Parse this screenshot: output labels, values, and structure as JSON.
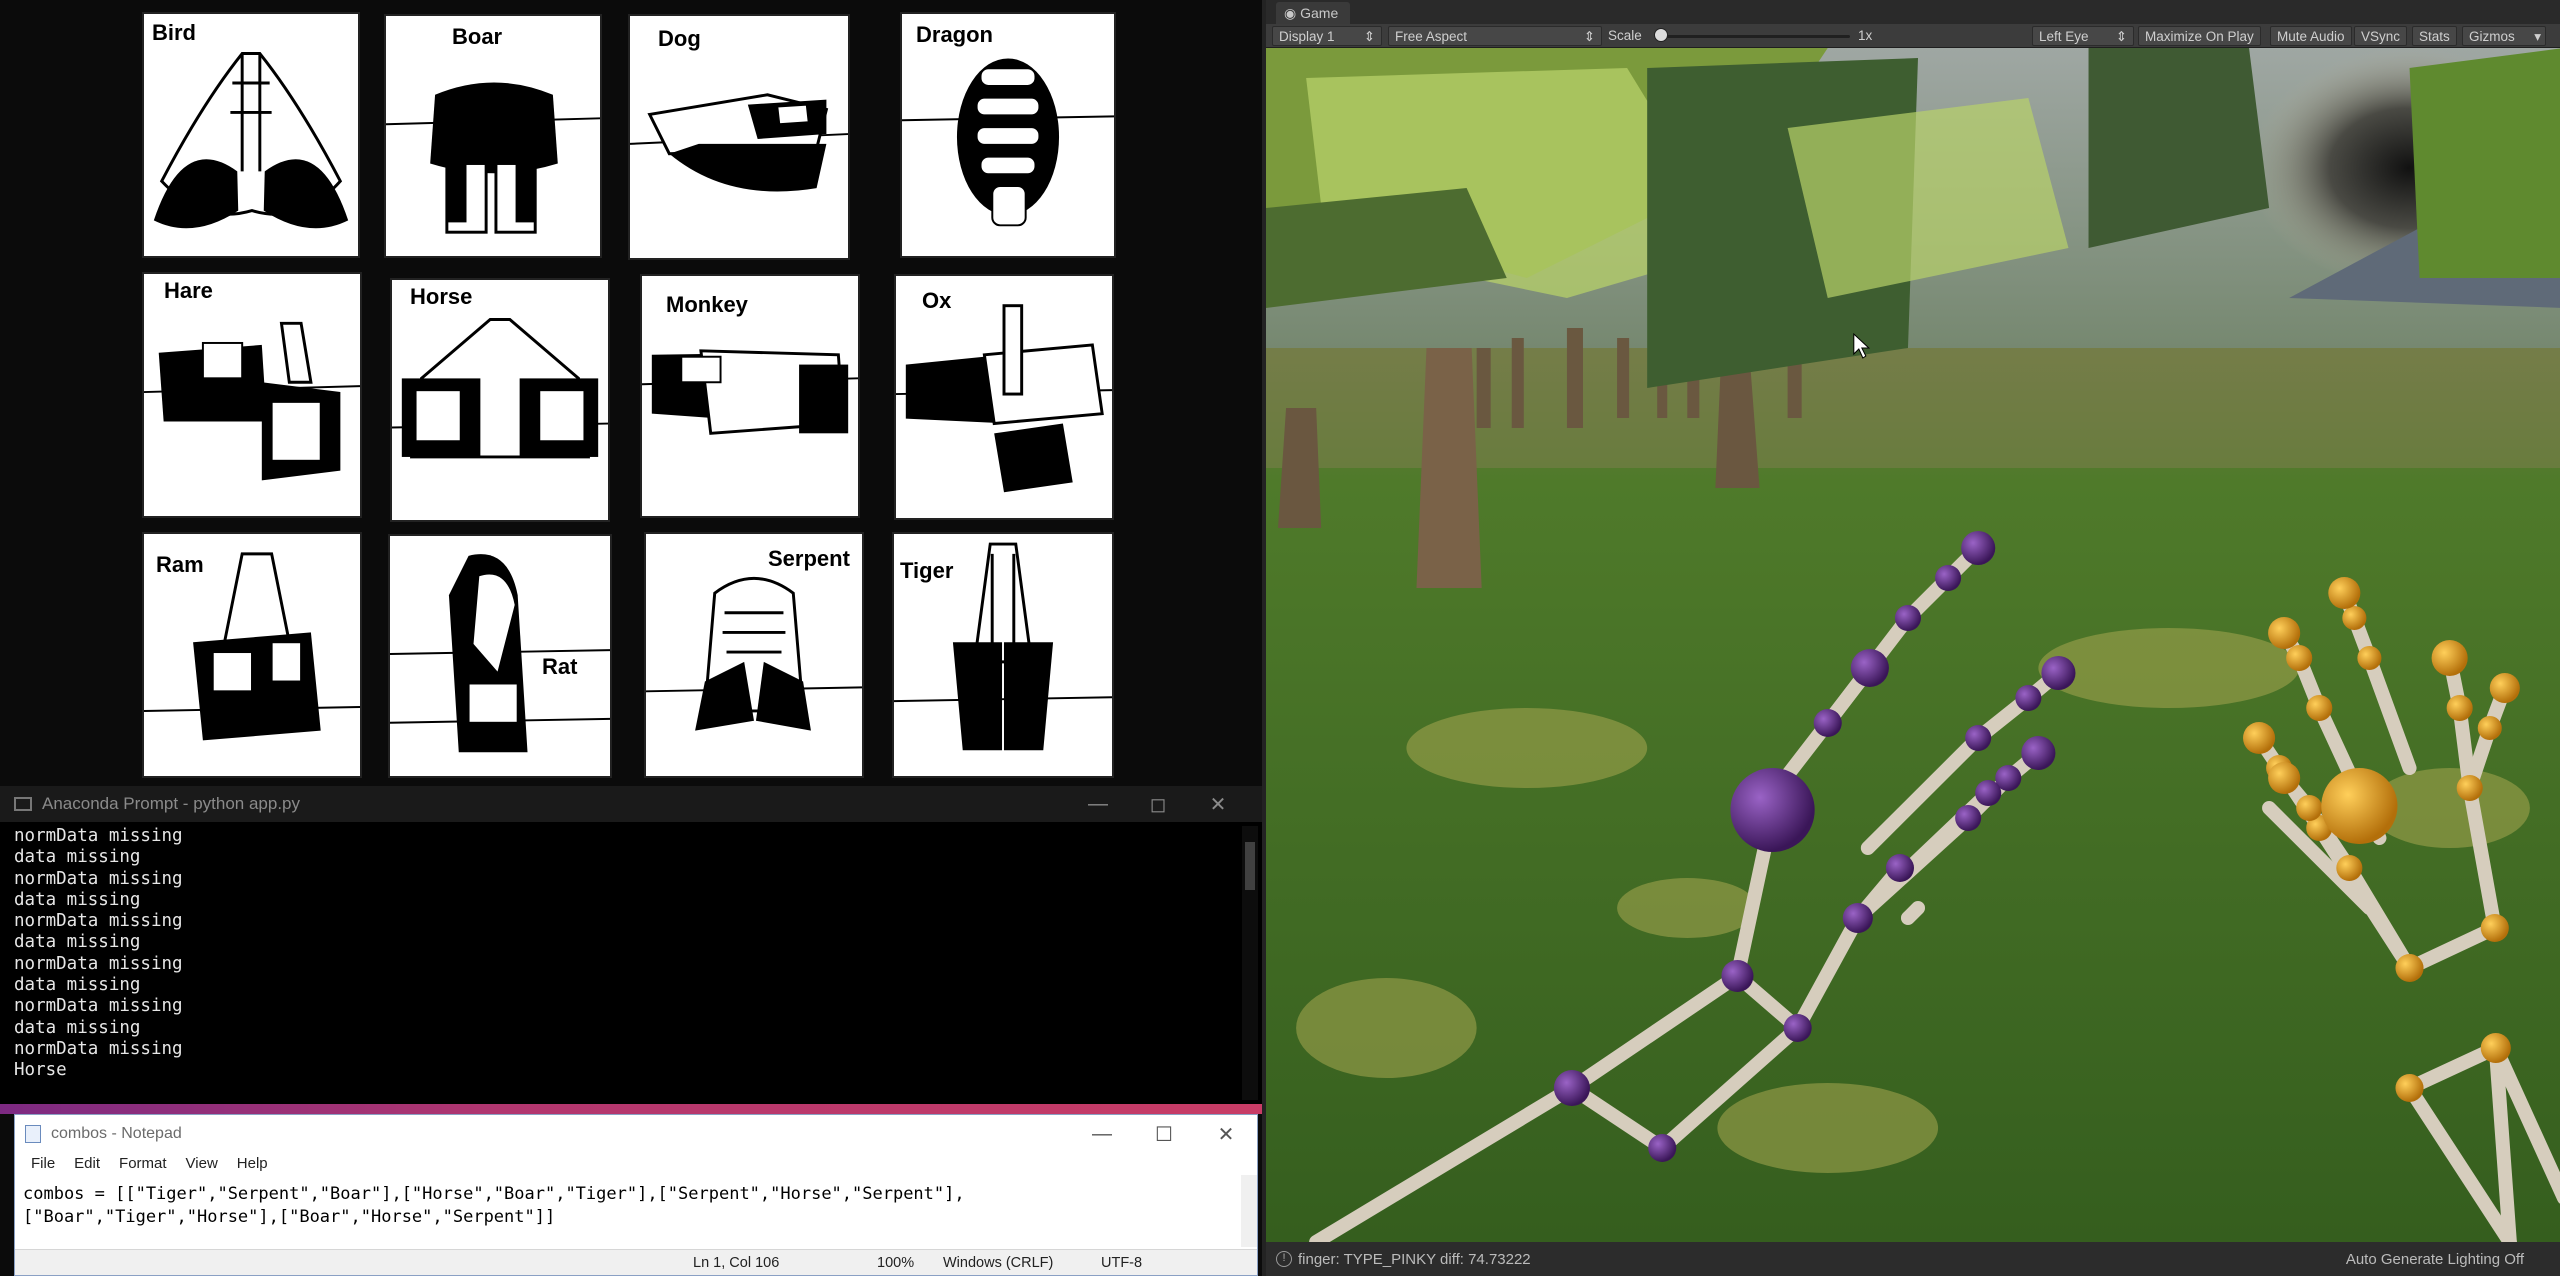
{
  "hand_signs": [
    {
      "name": "Bird"
    },
    {
      "name": "Boar"
    },
    {
      "name": "Dog"
    },
    {
      "name": "Dragon"
    },
    {
      "name": "Hare"
    },
    {
      "name": "Horse"
    },
    {
      "name": "Monkey"
    },
    {
      "name": "Ox"
    },
    {
      "name": "Ram"
    },
    {
      "name": "Rat"
    },
    {
      "name": "Serpent"
    },
    {
      "name": "Tiger"
    }
  ],
  "anaconda": {
    "title": "Anaconda Prompt - python  app.py",
    "lines": [
      "normData missing",
      "data missing",
      "normData missing",
      "data missing",
      "normData missing",
      "data missing",
      "normData missing",
      "data missing",
      "normData missing",
      "data missing",
      "normData missing",
      "Horse"
    ]
  },
  "notepad": {
    "title": "combos - Notepad",
    "menu": [
      "File",
      "Edit",
      "Format",
      "View",
      "Help"
    ],
    "content_lines": [
      "combos = [[\"Tiger\",\"Serpent\",\"Boar\"],[\"Horse\",\"Boar\",\"Tiger\"],[\"Serpent\",\"Horse\",\"Serpent\"],",
      "[\"Boar\",\"Tiger\",\"Horse\"],[\"Boar\",\"Horse\",\"Serpent\"]]"
    ],
    "status": {
      "position": "Ln 1, Col 106",
      "zoom": "100%",
      "line_ending": "Windows (CRLF)",
      "encoding": "UTF-8"
    }
  },
  "game": {
    "tab_title": "Game",
    "toolbar": {
      "display": "Display 1",
      "aspect": "Free Aspect",
      "scale_label": "Scale",
      "scale_value": "1x",
      "eye": "Left Eye",
      "maximize": "Maximize On Play",
      "mute": "Mute Audio",
      "vsync": "VSync",
      "stats": "Stats",
      "gizmos": "Gizmos"
    },
    "status_message": "finger: TYPE_PINKY diff: 74.73222",
    "status_right": "Auto Generate Lighting Off"
  },
  "colors": {
    "left_hand_joint": "#5a2a82",
    "right_hand_joint": "#e0981c",
    "bone": "#d8cfc0",
    "grass": "#3f6a2a"
  }
}
